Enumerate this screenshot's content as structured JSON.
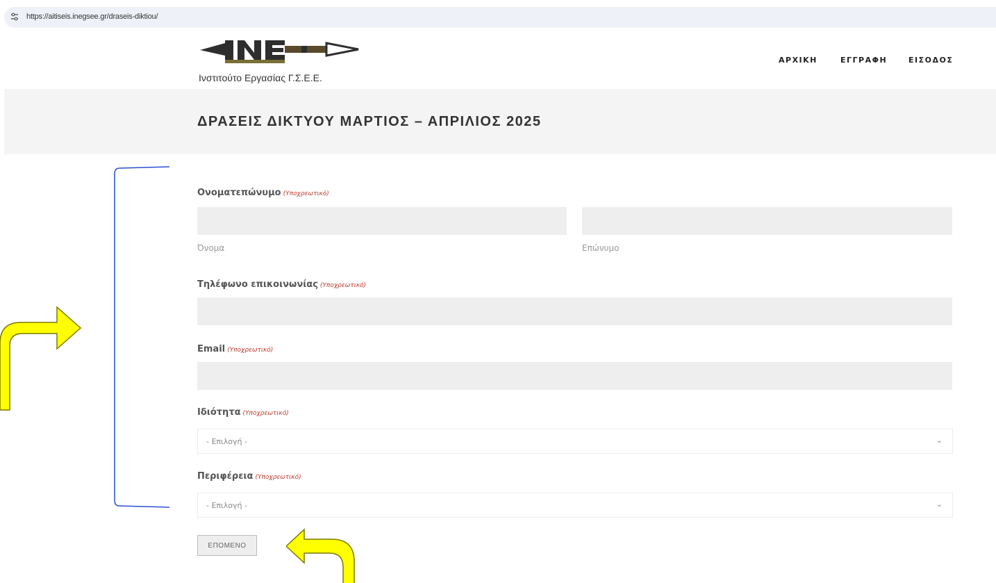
{
  "browser": {
    "url": "https://aitiseis.inegsee.gr/draseis-diktiou/"
  },
  "header": {
    "logo_text": "Ινστιτούτο Εργασίας Γ.Σ.Ε.Ε.",
    "nav": [
      "ΑΡΧΙΚΗ",
      "ΕΓΓΡΑΦΗ",
      "ΕΙΣΟΔΟΣ"
    ]
  },
  "page_title": "ΔΡΑΣΕΙΣ ΔΙΚΤΥΟΥ ΜΑΡΤΙΟΣ – ΑΠΡΙΛΙΟΣ 2025",
  "form": {
    "required_tag": "(Υποχρεωτικό)",
    "name": {
      "label": "Ονοματεπώνυμο",
      "first_sub": "Όνομα",
      "last_sub": "Επώνυμο",
      "first_value": "",
      "last_value": ""
    },
    "phone": {
      "label": "Τηλέφωνο επικοινωνίας",
      "value": ""
    },
    "email": {
      "label": "Email",
      "value": ""
    },
    "capacity": {
      "label": "Ιδιότητα",
      "selected": "- Επιλογή -"
    },
    "region": {
      "label": "Περιφέρεια",
      "selected": "- Επιλογή -"
    },
    "next_label": "ΕΠΟΜΕΝΟ"
  },
  "colors": {
    "annotation_arrow": "#ffff00",
    "annotation_bracket": "#2b4fd1",
    "required": "#c0392b",
    "field_bg": "#eeeeee"
  }
}
